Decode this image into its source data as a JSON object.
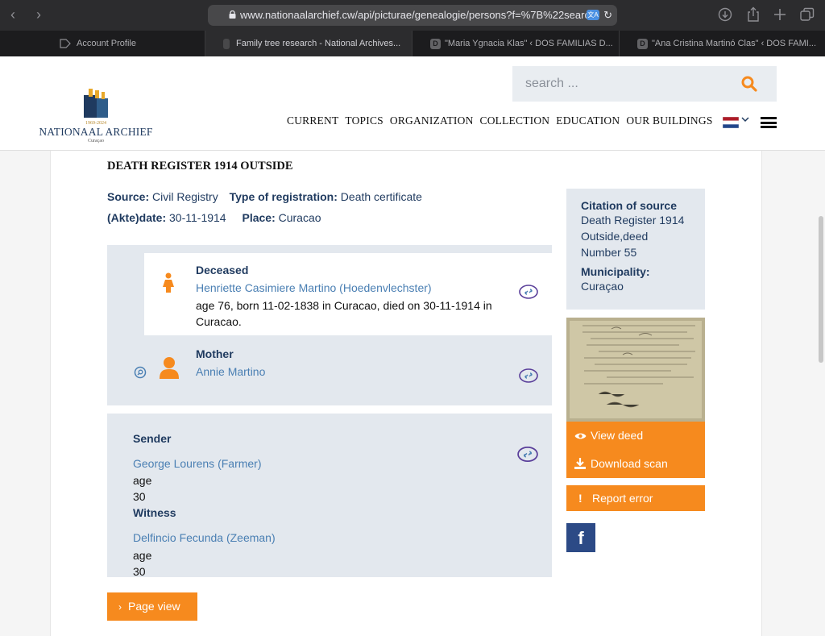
{
  "browser": {
    "url": "www.nationaalarchief.cw/api/picturae/genealogie/persons?f=%7B%22searc",
    "tabs": [
      {
        "title": "Account Profile",
        "favicon": ""
      },
      {
        "title": "Family tree research - National Archives...",
        "favicon": ""
      },
      {
        "title": "\"Maria Ygnacia Klas\" ‹ DOS FAMILIAS D...",
        "favicon": "D"
      },
      {
        "title": "\"Ana Cristina Martinó Clas\" ‹ DOS FAMI...",
        "favicon": "D"
      }
    ]
  },
  "site": {
    "logo_years": "1969-2024",
    "logo_name": "NATIONAAL ARCHIEF",
    "logo_sub": "Curaçao",
    "search_placeholder": "search ...",
    "nav": [
      "CURRENT",
      "TOPICS",
      "ORGANIZATION",
      "COLLECTION",
      "EDUCATION",
      "OUR BUILDINGS"
    ]
  },
  "record": {
    "title": "DEATH REGISTER 1914 OUTSIDE",
    "source_label": "Source:",
    "source_value": "Civil Registry",
    "type_label": "Type of registration:",
    "type_value": "Death certificate",
    "date_label": "(Akte)date:",
    "date_value": "30-11-1914",
    "place_label": "Place:",
    "place_value": "Curacao"
  },
  "persons": {
    "deceased": {
      "role": "Deceased",
      "name": "Henriette Casimiere Martino (Hoedenvlechster)",
      "detail_1": "age 76, born 11-02-1838 in Curacao, died on 30-11-1914 in",
      "detail_2": "Curacao."
    },
    "mother": {
      "role": "Mother",
      "name": "Annie Martino"
    },
    "sender": {
      "role": "Sender",
      "name": "George Lourens (Farmer)",
      "age": "age 30"
    },
    "witness": {
      "role": "Witness",
      "name": "Delfincio Fecunda (Zeeman)",
      "age": "age 30"
    }
  },
  "citation": {
    "heading": "Citation of source",
    "text_1": "Death Register 1914",
    "text_2": "Outside,deed",
    "text_3": "Number 55",
    "municipality_label": "Municipality:",
    "municipality_value": "Curaçao"
  },
  "actions": {
    "view_deed": "View deed",
    "download_scan": "Download scan",
    "report_error": "Report error",
    "page_view": "Page view"
  },
  "colors": {
    "accent": "#f68a1e",
    "navy": "#1f3a5f",
    "link": "#4a7fb3",
    "panel": "#e3e8ee",
    "facebook": "#2c4a86"
  }
}
